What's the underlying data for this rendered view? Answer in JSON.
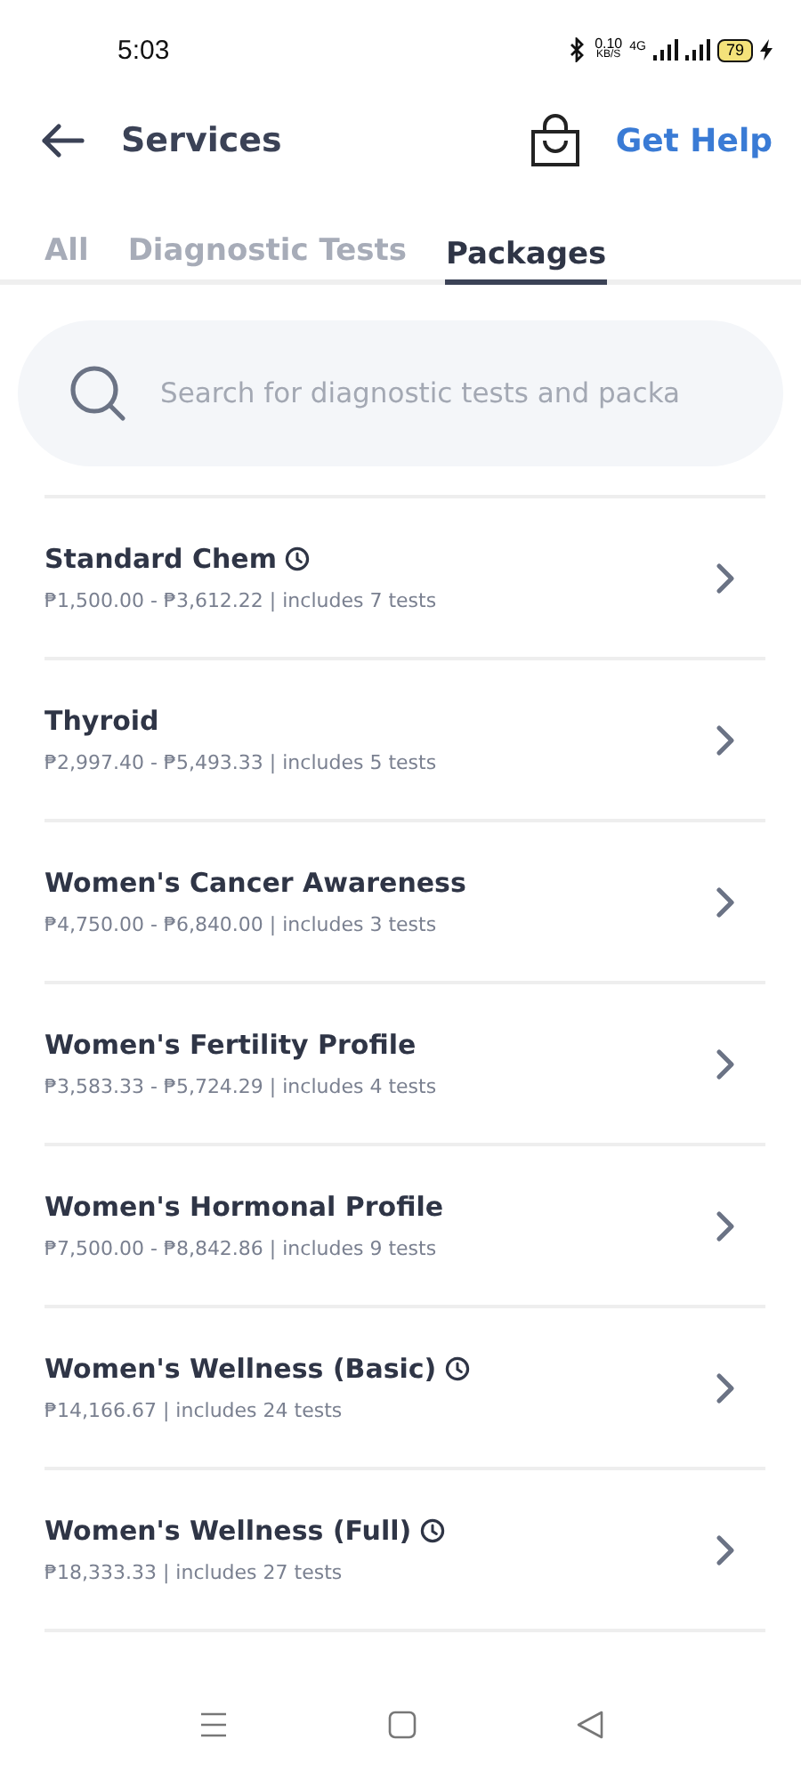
{
  "status_bar": {
    "time": "5:03",
    "speed": "0.10",
    "speed_unit": "KB/S",
    "network": "4G",
    "battery": "79"
  },
  "header": {
    "title": "Services",
    "help": "Get Help"
  },
  "tabs": [
    {
      "label": "All",
      "selected": false
    },
    {
      "label": "Diagnostic Tests",
      "selected": false
    },
    {
      "label": "Packages",
      "selected": true
    }
  ],
  "search": {
    "placeholder": "Search for diagnostic tests and packa"
  },
  "packages": [
    {
      "name": "Standard Chem",
      "timed": true,
      "details": "₱1,500.00 - ₱3,612.22 | includes 7 tests"
    },
    {
      "name": "Thyroid",
      "timed": false,
      "details": "₱2,997.40 - ₱5,493.33 | includes 5 tests"
    },
    {
      "name": "Women's Cancer Awareness",
      "timed": false,
      "details": "₱4,750.00 - ₱6,840.00 | includes 3 tests"
    },
    {
      "name": "Women's Fertility Profile",
      "timed": false,
      "details": "₱3,583.33 - ₱5,724.29 | includes 4 tests"
    },
    {
      "name": "Women's Hormonal Profile",
      "timed": false,
      "details": "₱7,500.00 - ₱8,842.86 | includes 9 tests"
    },
    {
      "name": "Women's Wellness (Basic)",
      "timed": true,
      "details": "₱14,166.67 | includes 24 tests"
    },
    {
      "name": "Women's Wellness (Full)",
      "timed": true,
      "details": "₱18,333.33 | includes 27 tests"
    }
  ]
}
